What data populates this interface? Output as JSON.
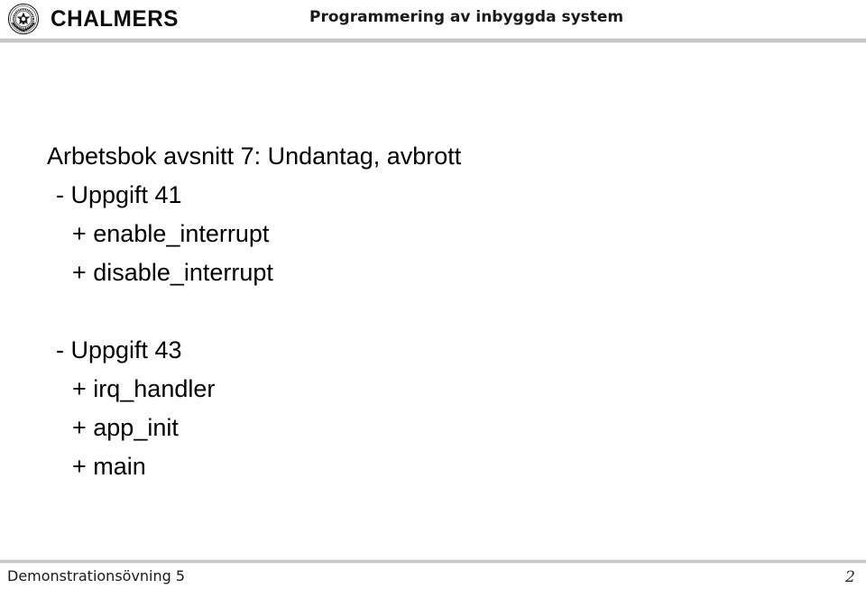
{
  "header": {
    "logo_name": "chalmers-seal",
    "wordmark": "CHALMERS",
    "course_title": "Programmering av inbyggda system"
  },
  "body": {
    "lines": [
      {
        "level": 0,
        "text": "Arbetsbok avsnitt 7: Undantag, avbrott"
      },
      {
        "level": 1,
        "text": "- Uppgift 41"
      },
      {
        "level": 2,
        "text": "+ enable_interrupt"
      },
      {
        "level": 2,
        "text": "+ disable_interrupt"
      },
      {
        "level": -1,
        "text": ""
      },
      {
        "level": 1,
        "text": "- Uppgift 43"
      },
      {
        "level": 2,
        "text": "+ irq_handler"
      },
      {
        "level": 2,
        "text": "+ app_init"
      },
      {
        "level": 2,
        "text": "+ main"
      }
    ]
  },
  "footer": {
    "label": "Demonstrationsövning 5",
    "page_number": "2"
  },
  "colors": {
    "text": "#000000",
    "rule": "#c6c6c6",
    "background": "#ffffff"
  }
}
